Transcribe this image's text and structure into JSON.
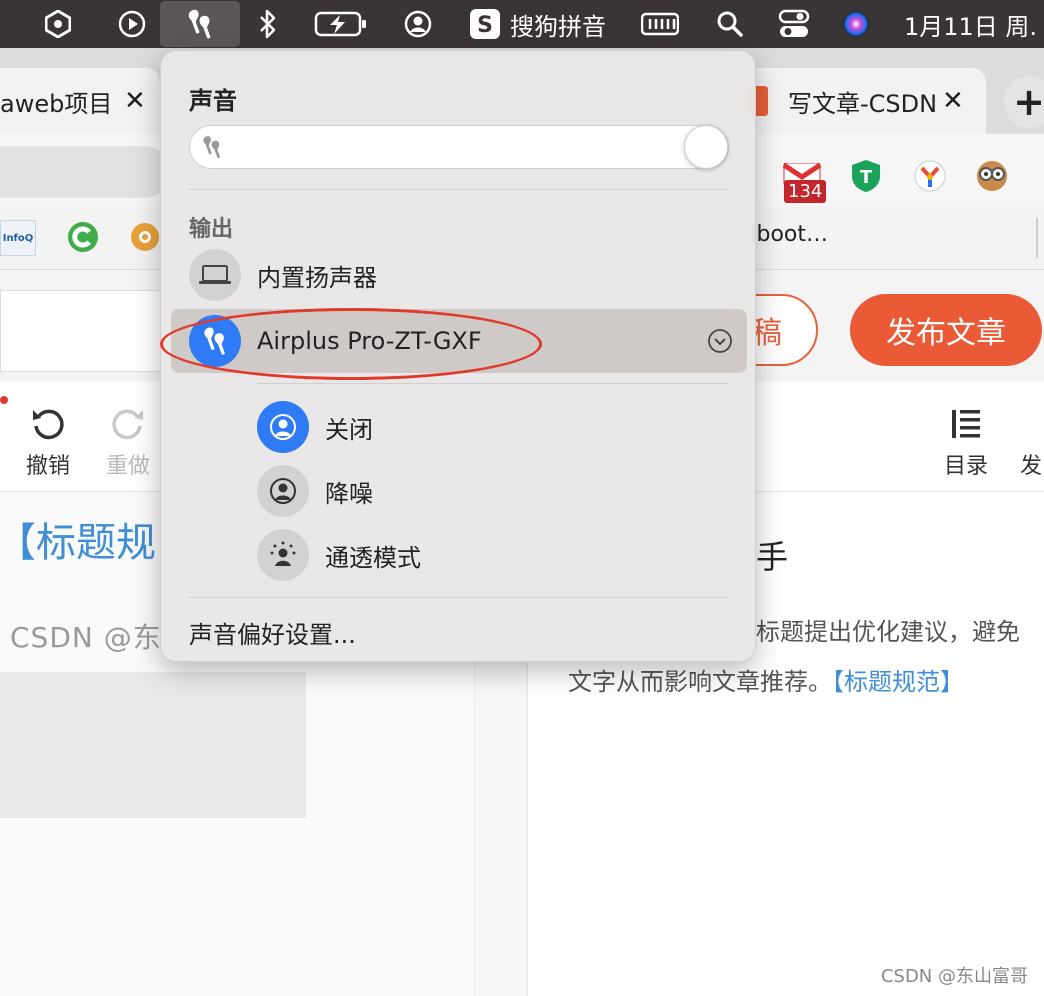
{
  "menubar": {
    "ime_label": "搜狗拼音",
    "clock": "1月11日 周."
  },
  "tabs": [
    {
      "label": "aweb项目"
    },
    {
      "label": "写文章-CSDN"
    }
  ],
  "newtab_label": "+",
  "bookmarks": {
    "gmail_badge": "134",
    "infoq_label": "InfoQ",
    "truncated_label": "Jboot…"
  },
  "page": {
    "draft_button_label": "稿",
    "publish_button_label": "发布文章",
    "undo_label": "撤销",
    "redo_label": "重做",
    "toc_label": "目录",
    "publish_short_label": "发",
    "title_link_text": "【标题规",
    "author_text": "CSDN @东",
    "side_heading": "手",
    "side_line1": "标题提出优化建议，避免",
    "side_line2": "文字从而影响文章推荐。",
    "side_link": "【标题规范】"
  },
  "sound_menu": {
    "title": "声音",
    "volume_level": 1.0,
    "output_header": "输出",
    "device_builtin": "内置扬声器",
    "device_airplus": "Airplus Pro-ZT-GXF",
    "mode_off": "关闭",
    "mode_anc": "降噪",
    "mode_transparency": "通透模式",
    "preferences": "声音偏好设置..."
  },
  "watermark": "CSDN @东山富哥",
  "colors": {
    "accent_blue": "#2f7af5",
    "publish_orange": "#ea5a36",
    "annotation_red": "#e03a2b"
  }
}
